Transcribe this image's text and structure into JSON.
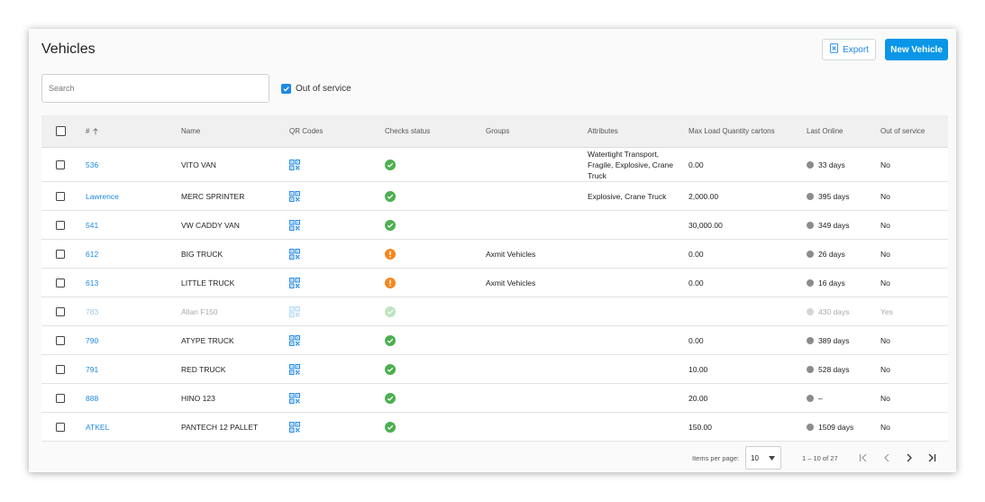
{
  "page": {
    "title": "Vehicles"
  },
  "toolbar": {
    "export_label": "Export",
    "new_label": "New Vehicle"
  },
  "search": {
    "placeholder": "Search",
    "value": ""
  },
  "filter": {
    "out_of_service_label": "Out of service",
    "out_of_service_checked": true
  },
  "table": {
    "headers": {
      "id": "#",
      "name": "Name",
      "qr": "QR Codes",
      "checks": "Checks status",
      "groups": "Groups",
      "attributes": "Attributes",
      "max_load": "Max Load Quantity cartons",
      "last_online": "Last Online",
      "out_of_service": "Out of service"
    },
    "rows": [
      {
        "id": "536",
        "name": "VITO VAN",
        "check": "ok",
        "groups": "",
        "attributes": "Watertight Transport, Fragile, Explosive, Crane Truck",
        "max_load": "0.00",
        "last_online": "33 days",
        "oos": "No",
        "dimmed": false
      },
      {
        "id": "Lawrence",
        "name": "MERC SPRINTER",
        "check": "ok",
        "groups": "",
        "attributes": "Explosive, Crane Truck",
        "max_load": "2,000.00",
        "last_online": "395 days",
        "oos": "No",
        "dimmed": false
      },
      {
        "id": "541",
        "name": "VW CADDY VAN",
        "check": "ok",
        "groups": "",
        "attributes": "",
        "max_load": "30,000.00",
        "last_online": "349 days",
        "oos": "No",
        "dimmed": false
      },
      {
        "id": "612",
        "name": "BIG TRUCK",
        "check": "warn",
        "groups": "Axmit Vehicles",
        "attributes": "",
        "max_load": "0.00",
        "last_online": "26 days",
        "oos": "No",
        "dimmed": false
      },
      {
        "id": "613",
        "name": "LITTLE TRUCK",
        "check": "warn",
        "groups": "Axmit Vehicles",
        "attributes": "",
        "max_load": "0.00",
        "last_online": "16 days",
        "oos": "No",
        "dimmed": false
      },
      {
        "id": "783",
        "name": "Allan F150",
        "check": "ok",
        "groups": "",
        "attributes": "",
        "max_load": "",
        "last_online": "430 days",
        "oos": "Yes",
        "dimmed": true
      },
      {
        "id": "790",
        "name": "ATYPE TRUCK",
        "check": "ok",
        "groups": "",
        "attributes": "",
        "max_load": "0.00",
        "last_online": "389 days",
        "oos": "No",
        "dimmed": false
      },
      {
        "id": "791",
        "name": "RED TRUCK",
        "check": "ok",
        "groups": "",
        "attributes": "",
        "max_load": "10.00",
        "last_online": "528 days",
        "oos": "No",
        "dimmed": false
      },
      {
        "id": "888",
        "name": "HINO 123",
        "check": "ok",
        "groups": "",
        "attributes": "",
        "max_load": "20.00",
        "last_online": "–",
        "oos": "No",
        "dimmed": false
      },
      {
        "id": "ATKEL",
        "name": "PANTECH 12 PALLET",
        "check": "ok",
        "groups": "",
        "attributes": "",
        "max_load": "150.00",
        "last_online": "1509 days",
        "oos": "No",
        "dimmed": false
      }
    ]
  },
  "pagination": {
    "items_per_page_label": "Items per page:",
    "items_per_page": "10",
    "range": "1 – 10 of 27"
  },
  "colors": {
    "accent": "#1e88e5",
    "primary_button": "#0a96e8",
    "ok": "#4caf50",
    "warn": "#f5861f",
    "dot": "#8c8c8c"
  },
  "icons": {
    "export": "excel-file-icon",
    "sort": "arrow-up-icon",
    "qr": "qr-code-icon",
    "check_ok": "check-circle-icon",
    "check_warn": "exclamation-circle-icon",
    "first": "first-page-icon",
    "prev": "chevron-left-icon",
    "next": "chevron-right-icon",
    "last": "last-page-icon"
  }
}
